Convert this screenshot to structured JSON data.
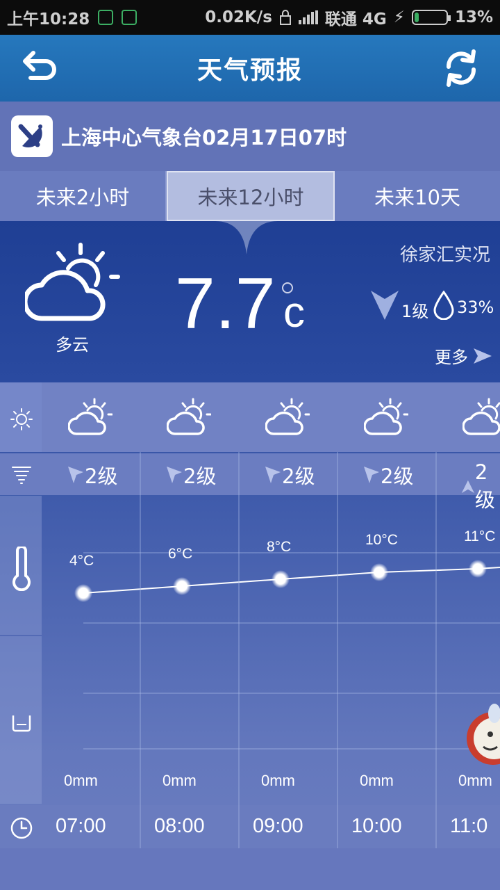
{
  "status_bar": {
    "time": "上午10:28",
    "speed": "0.02K/s",
    "carrier": "联通 4G",
    "battery": "13%",
    "battery_level": 0.13
  },
  "header": {
    "title": "天气预报"
  },
  "source": {
    "text": "上海中心气象台02月17日07时"
  },
  "tabs": [
    {
      "label": "未来2小时",
      "active": false
    },
    {
      "label": "未来12小时",
      "active": true
    },
    {
      "label": "未来10天",
      "active": false
    }
  ],
  "current": {
    "station": "徐家汇实况",
    "condition": "多云",
    "condition_icon": "partly-cloudy-icon",
    "temperature": "7.7",
    "unit": "c",
    "wind": "1级",
    "humidity": "33%",
    "more": "更多"
  },
  "forecast": {
    "hours": [
      {
        "time": "07:00",
        "wind": "2级",
        "temp": "4°C",
        "temp_value": 4,
        "rain": "0mm",
        "wind_dir": "se"
      },
      {
        "time": "08:00",
        "wind": "2级",
        "temp": "6°C",
        "temp_value": 6,
        "rain": "0mm",
        "wind_dir": "se"
      },
      {
        "time": "09:00",
        "wind": "2级",
        "temp": "8°C",
        "temp_value": 8,
        "rain": "0mm",
        "wind_dir": "se"
      },
      {
        "time": "10:00",
        "wind": "2级",
        "temp": "10°C",
        "temp_value": 10,
        "rain": "0mm",
        "wind_dir": "se"
      },
      {
        "time": "11:0",
        "wind": "2级",
        "temp": "11°C",
        "temp_value": 11,
        "rain": "0mm",
        "wind_dir": "n"
      }
    ]
  },
  "colors": {
    "accent": "#1e66ab",
    "panel": "#1f3f94",
    "background": "#5a6bb0"
  }
}
